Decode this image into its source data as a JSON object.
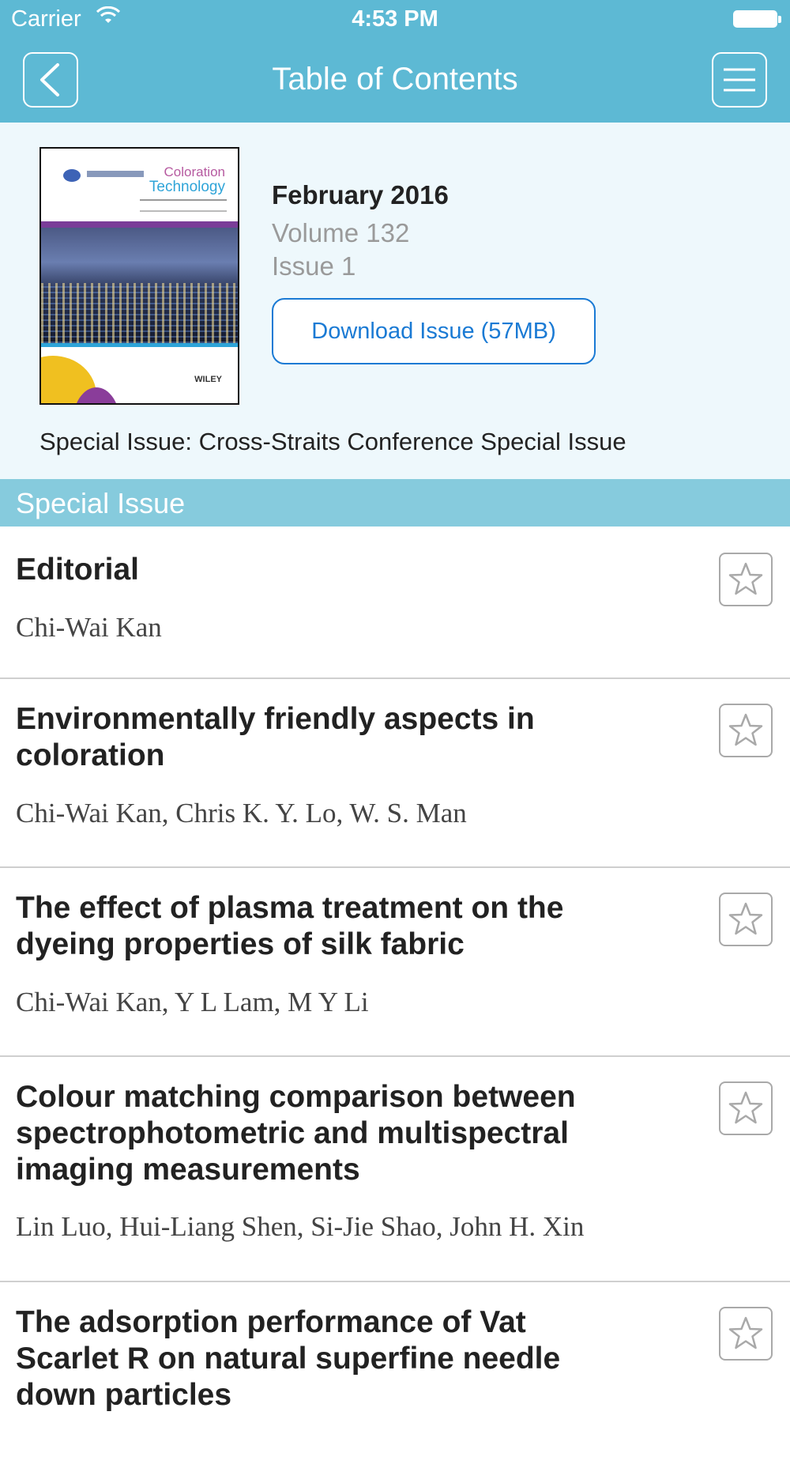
{
  "status_bar": {
    "carrier": "Carrier",
    "time": "4:53 PM"
  },
  "nav": {
    "title": "Table of Contents",
    "back_icon": "chevron-left-icon",
    "menu_icon": "hamburger-menu-icon"
  },
  "issue": {
    "date": "February 2016",
    "volume": "Volume 132",
    "issue": "Issue 1",
    "download_label": "Download Issue (57MB)",
    "special_note": "Special Issue: Cross-Straits Conference Special Issue",
    "cover": {
      "title_line1": "Coloration",
      "title_line2": "Technology",
      "publisher": "WILEY"
    }
  },
  "section": {
    "label": "Special Issue"
  },
  "articles": [
    {
      "title_lines": [
        "Editorial"
      ],
      "authors": "Chi-Wai Kan"
    },
    {
      "title_lines": [
        "Environmentally friendly aspects in",
        "coloration"
      ],
      "authors": "Chi-Wai Kan, Chris K. Y. Lo, W. S. Man"
    },
    {
      "title_lines": [
        "The effect of plasma treatment on the",
        "dyeing properties of silk fabric"
      ],
      "authors": "Chi-Wai Kan, Y L Lam, M Y Li"
    },
    {
      "title_lines": [
        "Colour matching comparison between",
        "spectrophotometric and multispectral",
        "imaging measurements"
      ],
      "authors": "Lin Luo, Hui-Liang Shen, Si-Jie Shao, John H. Xin"
    },
    {
      "title_lines": [
        "The adsorption performance of Vat",
        "Scarlet R on natural superfine needle",
        "down particles"
      ],
      "authors": ""
    }
  ],
  "colors": {
    "nav_bar": "#5db9d4",
    "section_header": "#86cbdd",
    "issue_panel": "#eef8fc",
    "download_accent": "#1a7ad4"
  }
}
